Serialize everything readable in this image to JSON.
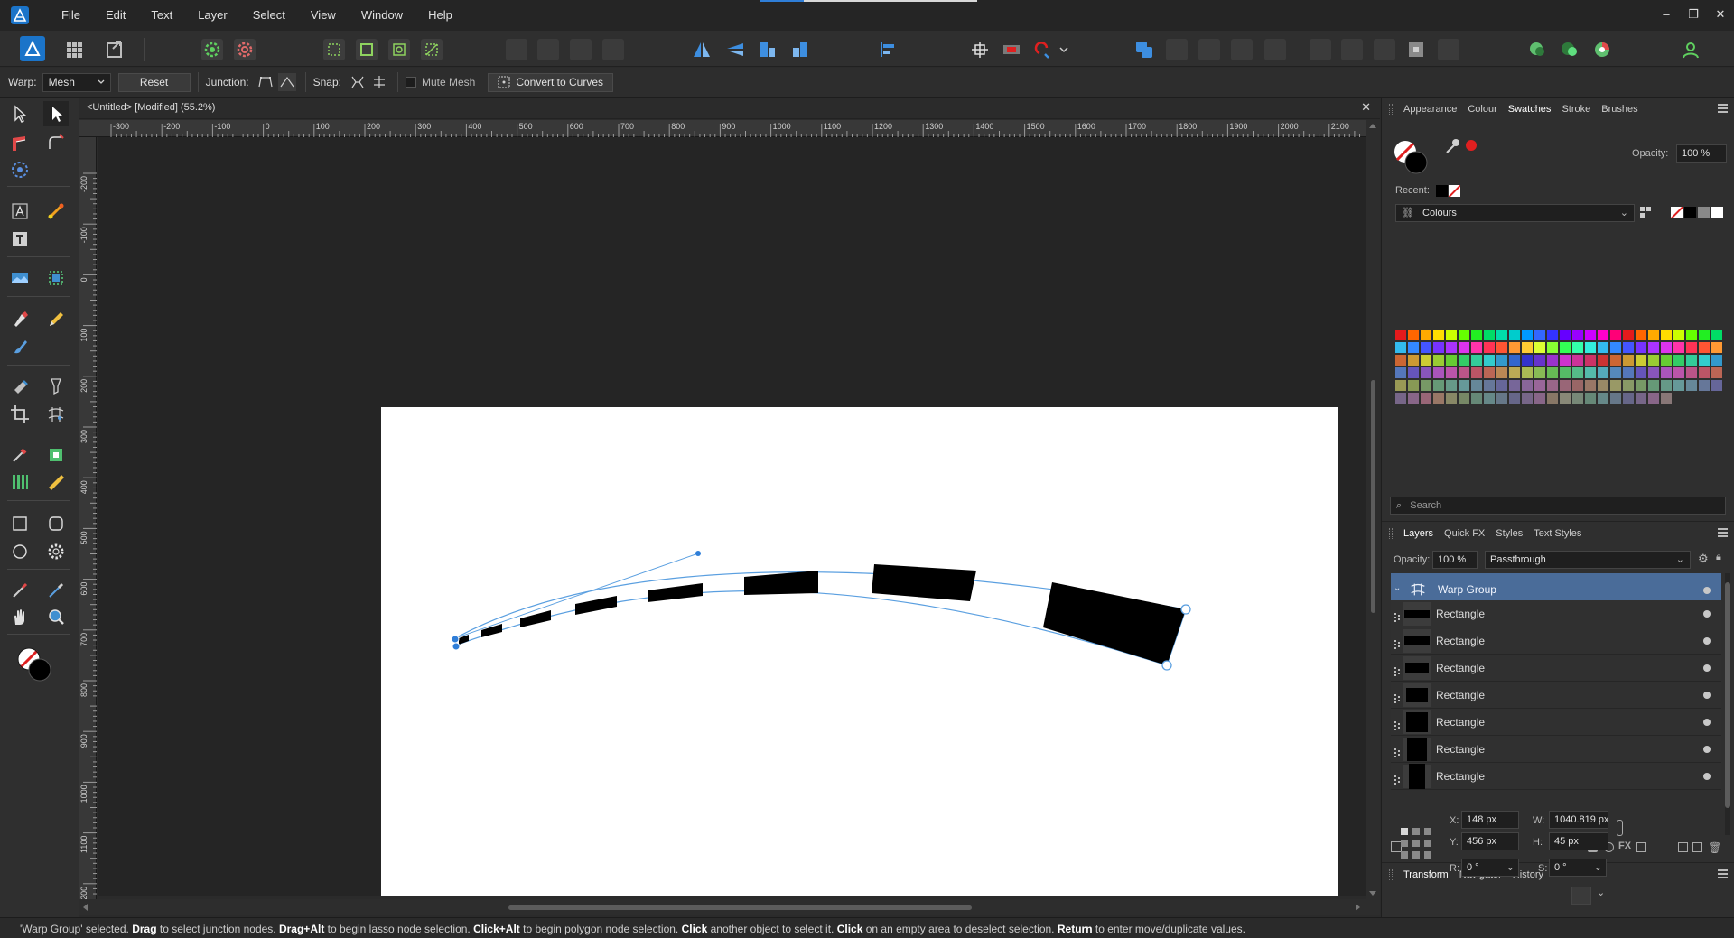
{
  "app": {
    "menu": [
      "File",
      "Edit",
      "Text",
      "Layer",
      "Select",
      "View",
      "Window",
      "Help"
    ],
    "window_controls": [
      "–",
      "❐",
      "✕"
    ]
  },
  "context": {
    "warp_label": "Warp:",
    "warp_value": "Mesh",
    "reset_label": "Reset",
    "junction_label": "Junction:",
    "snap_label": "Snap:",
    "mute_mesh_label": "Mute Mesh",
    "convert_label": "Convert to Curves"
  },
  "document": {
    "title": "<Untitled> [Modified] (55.2%)",
    "close": "✕",
    "ruler_h_labels": [
      "-300",
      "-200",
      "-100",
      "0",
      "100",
      "200",
      "300",
      "400",
      "500",
      "600",
      "700",
      "800",
      "900",
      "1000",
      "1100",
      "1200",
      "1300",
      "1400",
      "1500",
      "1600",
      "1700",
      "1800",
      "1900",
      "2000",
      "2100"
    ],
    "ruler_v_labels": [
      "-200",
      "-100",
      "0",
      "100",
      "200",
      "300",
      "400",
      "500",
      "600",
      "700",
      "800",
      "900",
      "1000",
      "1100",
      "1200"
    ]
  },
  "top_panel": {
    "tabs": [
      "Appearance",
      "Colour",
      "Swatches",
      "Stroke",
      "Brushes"
    ],
    "active_tab": "Swatches",
    "opacity_label": "Opacity:",
    "opacity_value": "100 %",
    "recent_label": "Recent:",
    "palette_name": "Colours",
    "search_placeholder": "Search",
    "swatch_colors": [
      "#e41a1c",
      "#ff6600",
      "#ffaa00",
      "#ffdd00",
      "#ccff00",
      "#66ff00",
      "#22ee22",
      "#00dd66",
      "#00ddaa",
      "#00cccc",
      "#0099ff",
      "#3366ff",
      "#3333ff",
      "#6600ff",
      "#9900ff",
      "#cc00ff",
      "#ff00cc",
      "#ff0077",
      "#e41a1c",
      "#ff6600",
      "#ffaa00",
      "#ffdd00",
      "#ccff00",
      "#66ff00",
      "#22ee22",
      "#00dd66",
      "#33bbee",
      "#3388ff",
      "#4455ff",
      "#7733ff",
      "#aa33ff",
      "#dd33ee",
      "#ff33aa",
      "#ff3355",
      "#ff5533",
      "#ff9933",
      "#ffcc33",
      "#ddff33",
      "#88ff33",
      "#33ff55",
      "#33ffaa",
      "#33eedd",
      "#33bbee",
      "#3388ff",
      "#4455ff",
      "#7733ff",
      "#aa33ff",
      "#dd33ee",
      "#ff33aa",
      "#ff3355",
      "#ff5533",
      "#ff9933",
      "#cc6633",
      "#cc9933",
      "#cccc33",
      "#99cc33",
      "#66cc33",
      "#33cc66",
      "#33cc99",
      "#33cccc",
      "#3399cc",
      "#3366cc",
      "#3333cc",
      "#6633cc",
      "#9933cc",
      "#cc33cc",
      "#cc3399",
      "#cc3366",
      "#cc3333",
      "#cc6633",
      "#cc9933",
      "#cccc33",
      "#99cc33",
      "#66cc33",
      "#33cc66",
      "#33cc99",
      "#33cccc",
      "#3399cc",
      "#5577bb",
      "#6655bb",
      "#8855bb",
      "#aa55bb",
      "#bb55aa",
      "#bb5588",
      "#bb5566",
      "#bb6655",
      "#bb8855",
      "#bbaa55",
      "#aabb55",
      "#88bb55",
      "#66bb55",
      "#55bb66",
      "#55bb88",
      "#55bbaa",
      "#55aabb",
      "#5588bb",
      "#5577bb",
      "#6655bb",
      "#8855bb",
      "#aa55bb",
      "#bb55aa",
      "#bb5588",
      "#bb5566",
      "#bb6655",
      "#999955",
      "#889955",
      "#779966",
      "#669977",
      "#669988",
      "#669999",
      "#668899",
      "#667799",
      "#666699",
      "#776699",
      "#886699",
      "#996699",
      "#996688",
      "#996677",
      "#996666",
      "#997766",
      "#998866",
      "#999966",
      "#889966",
      "#779966",
      "#669977",
      "#669988",
      "#669999",
      "#668899",
      "#667799",
      "#666699",
      "#776688",
      "#886688",
      "#996677",
      "#997766",
      "#888866",
      "#778866",
      "#668877",
      "#668888",
      "#667788",
      "#666688",
      "#776688",
      "#886688",
      "#887766",
      "#888877",
      "#778877",
      "#668877",
      "#668888",
      "#667788",
      "#666688",
      "#776688",
      "#886688",
      "#887777"
    ]
  },
  "layers_panel": {
    "tabs": [
      "Layers",
      "Quick FX",
      "Styles",
      "Text Styles"
    ],
    "active_tab": "Layers",
    "opacity_label": "Opacity:",
    "opacity_value": "100 %",
    "blend_mode": "Passthrough",
    "rows": [
      {
        "name": "Warp Group"
      },
      {
        "name": "Rectangle"
      },
      {
        "name": "Rectangle"
      },
      {
        "name": "Rectangle"
      },
      {
        "name": "Rectangle"
      },
      {
        "name": "Rectangle"
      },
      {
        "name": "Rectangle"
      },
      {
        "name": "Rectangle"
      }
    ]
  },
  "transform_panel": {
    "tabs": [
      "Transform",
      "Navigator",
      "History"
    ],
    "active_tab": "Transform",
    "x_label": "X:",
    "x_value": "148 px",
    "y_label": "Y:",
    "y_value": "456 px",
    "w_label": "W:",
    "w_value": "1040.819 px",
    "h_label": "H:",
    "h_value": "45 px",
    "r_label": "R:",
    "r_value": "0 °",
    "s_label": "S:",
    "s_value": "0 °"
  },
  "status": {
    "p1": "'Warp Group' selected. ",
    "b1": "Drag",
    "p2": " to select junction nodes. ",
    "b2": "Drag+Alt",
    "p3": " to begin lasso node selection. ",
    "b3": "Click+Alt",
    "p4": " to begin polygon node selection. ",
    "b4": "Click",
    "p5": " another object to select it. ",
    "b5": "Click",
    "p6": " on an empty area to deselect selection. ",
    "b6": "Return",
    "p7": " to enter move/duplicate values."
  },
  "colors": {
    "selection": "#4a6c99",
    "accent_blue": "#2f7ed8",
    "accent_red": "#e02020"
  }
}
